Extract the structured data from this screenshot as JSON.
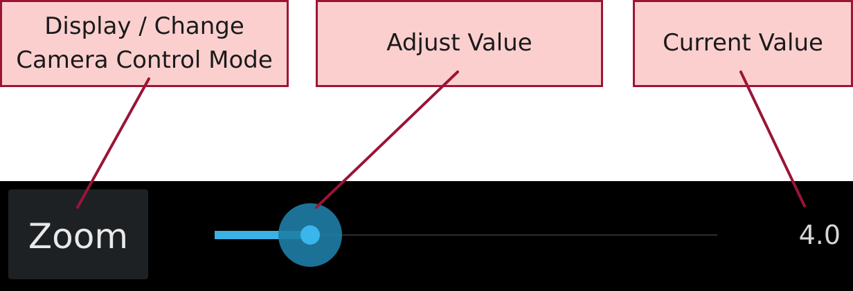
{
  "callouts": {
    "mode": {
      "line1": "Display / Change",
      "line2": "Camera Control Mode"
    },
    "adjust": {
      "label": "Adjust Value"
    },
    "current": {
      "label": "Current Value"
    }
  },
  "control_bar": {
    "mode_label": "Zoom",
    "slider_fraction": 0.19,
    "value_text": "4.0"
  },
  "colors": {
    "callout_fill": "#fccfcf",
    "callout_border": "#9b1436",
    "leader_line": "#9b1436",
    "bar_background": "#000000",
    "slider_accent": "#3bb2e6"
  }
}
